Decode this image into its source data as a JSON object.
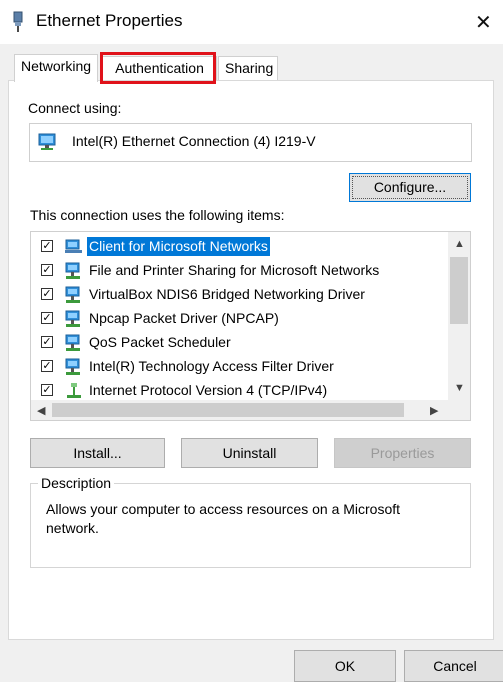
{
  "window": {
    "title": "Ethernet Properties"
  },
  "tabs": [
    {
      "label": "Networking"
    },
    {
      "label": "Authentication"
    },
    {
      "label": "Sharing"
    }
  ],
  "connect_using": {
    "label": "Connect using:",
    "adapter": "Intel(R) Ethernet Connection (4) I219-V",
    "configure_label": "Configure..."
  },
  "items_section": {
    "label": "This connection uses the following items:",
    "items": [
      {
        "label": "Client for Microsoft Networks",
        "checked": true,
        "selected": true,
        "icon": "network-client-icon"
      },
      {
        "label": "File and Printer Sharing for Microsoft Networks",
        "checked": true,
        "icon": "network-service-icon"
      },
      {
        "label": "VirtualBox NDIS6 Bridged Networking Driver",
        "checked": true,
        "icon": "network-service-icon"
      },
      {
        "label": "Npcap Packet Driver (NPCAP)",
        "checked": true,
        "icon": "network-service-icon"
      },
      {
        "label": "QoS Packet Scheduler",
        "checked": true,
        "icon": "network-service-icon"
      },
      {
        "label": "Intel(R) Technology Access Filter Driver",
        "checked": true,
        "icon": "network-service-icon"
      },
      {
        "label": "Internet Protocol Version 4 (TCP/IPv4)",
        "checked": true,
        "icon": "protocol-icon"
      }
    ]
  },
  "buttons": {
    "install": "Install...",
    "uninstall": "Uninstall",
    "properties": "Properties",
    "ok": "OK",
    "cancel": "Cancel"
  },
  "description": {
    "legend": "Description",
    "text": "Allows your computer to access resources on a Microsoft network."
  },
  "colors": {
    "selection": "#0078d7",
    "highlight_box": "#e0121a"
  }
}
